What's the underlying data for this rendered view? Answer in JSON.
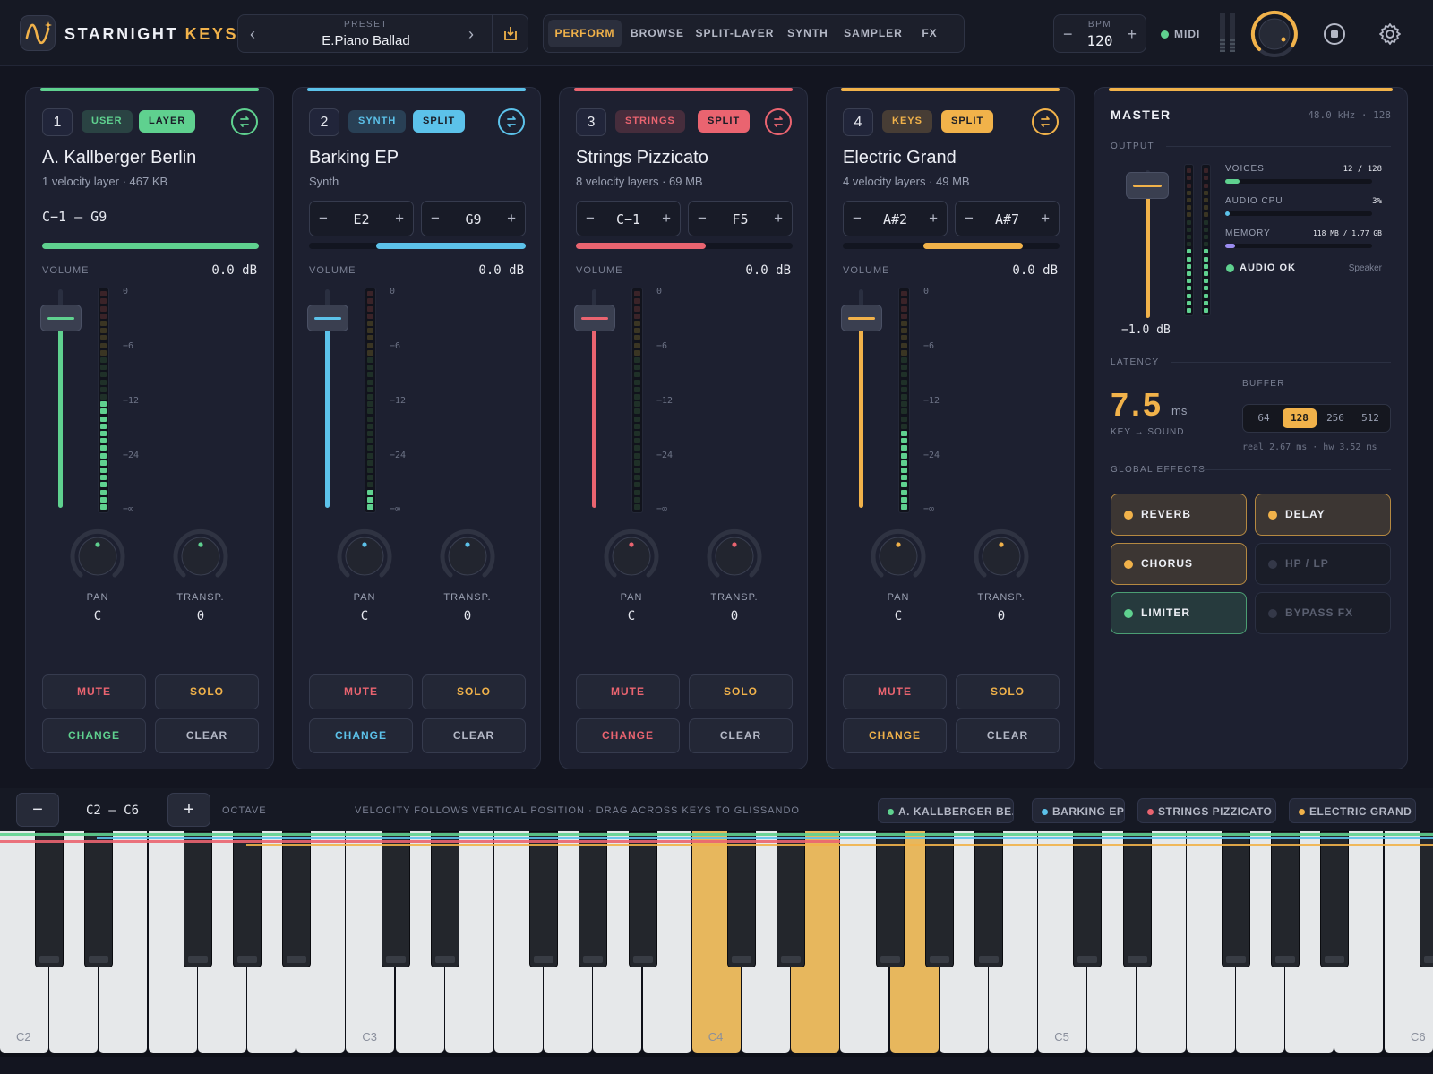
{
  "app": {
    "name_a": "STARNIGHT",
    "name_b": "KEYS"
  },
  "preset": {
    "label": "PRESET",
    "value": "E.Piano Ballad"
  },
  "nav": {
    "tabs": [
      "PERFORM",
      "BROWSE",
      "SPLIT-LAYER",
      "SYNTH",
      "SAMPLER",
      "FX"
    ],
    "active": "PERFORM"
  },
  "bpm": {
    "label": "BPM",
    "value": "120",
    "minus": "−",
    "plus": "+"
  },
  "midi": {
    "label": "MIDI"
  },
  "colors": {
    "green": "#5fd18f",
    "blue": "#5cc2ea",
    "red": "#ea6470",
    "orange": "#f1b24a",
    "purple": "#9b8cf0"
  },
  "channels": [
    {
      "num": "1",
      "tag": "USER",
      "mode": "LAYER",
      "name": "A. Kallberger Berlin",
      "sub": "1 velocity layer · 467 KB",
      "range_text": "C−1 — G9",
      "range_low": "",
      "range_high": "",
      "range_start": 0,
      "range_end": 1,
      "volume_label": "VOLUME",
      "volume": "0.0 dB",
      "fader": 0.9,
      "meter": 0.5,
      "pan_label": "PAN",
      "pan": "C",
      "transp_label": "TRANSP.",
      "transp": "0",
      "mute": "MUTE",
      "solo": "SOLO",
      "change": "CHANGE",
      "clear": "CLEAR",
      "color": "#5fd18f"
    },
    {
      "num": "2",
      "tag": "SYNTH",
      "mode": "SPLIT",
      "name": "Barking EP",
      "sub": "Synth",
      "range_text": "",
      "range_low": "E2",
      "range_high": "G9",
      "range_start": 0.31,
      "range_end": 1,
      "volume_label": "VOLUME",
      "volume": "0.0 dB",
      "fader": 0.9,
      "meter": 0.1,
      "pan_label": "PAN",
      "pan": "C",
      "transp_label": "TRANSP.",
      "transp": "0",
      "mute": "MUTE",
      "solo": "SOLO",
      "change": "CHANGE",
      "clear": "CLEAR",
      "color": "#5cc2ea"
    },
    {
      "num": "3",
      "tag": "STRINGS",
      "mode": "SPLIT",
      "name": "Strings Pizzicato",
      "sub": "8 velocity layers · 69 MB",
      "range_text": "",
      "range_low": "C−1",
      "range_high": "F5",
      "range_start": 0,
      "range_end": 0.6,
      "volume_label": "VOLUME",
      "volume": "0.0 dB",
      "fader": 0.9,
      "meter": 0,
      "pan_label": "PAN",
      "pan": "C",
      "transp_label": "TRANSP.",
      "transp": "0",
      "mute": "MUTE",
      "solo": "SOLO",
      "change": "CHANGE",
      "clear": "CLEAR",
      "color": "#ea6470"
    },
    {
      "num": "4",
      "tag": "KEYS",
      "mode": "SPLIT",
      "name": "Electric Grand",
      "sub": "4 velocity layers · 49 MB",
      "range_text": "",
      "range_low": "A#2",
      "range_high": "A#7",
      "range_start": 0.37,
      "range_end": 0.83,
      "volume_label": "VOLUME",
      "volume": "0.0 dB",
      "fader": 0.9,
      "meter": 0.35,
      "pan_label": "PAN",
      "pan": "C",
      "transp_label": "TRANSP.",
      "transp": "0",
      "mute": "MUTE",
      "solo": "SOLO",
      "change": "CHANGE",
      "clear": "CLEAR",
      "color": "#f1b24a"
    }
  ],
  "scale": [
    "0",
    "−6",
    "−12",
    "−24",
    "−∞"
  ],
  "master": {
    "title": "MASTER",
    "sr": "48.0 kHz · 128",
    "output_label": "OUTPUT",
    "output_db": "−1.0 dB",
    "fader": 0.9,
    "voices_label": "VOICES",
    "voices": "12 / 128",
    "voices_frac": 0.1,
    "cpu_label": "AUDIO CPU",
    "cpu": "3%",
    "cpu_frac": 0.03,
    "mem_label": "MEMORY",
    "mem": "118 MB / 1.77 GB",
    "mem_frac": 0.07,
    "audio_ok": "AUDIO OK",
    "device": "Speaker",
    "latency_label": "LATENCY",
    "latency": "7.5",
    "latency_unit": "ms",
    "key_sound": "KEY → SOUND",
    "buffer_label": "BUFFER",
    "buffers": [
      "64",
      "128",
      "256",
      "512"
    ],
    "buffer_sel": "128",
    "real": "real 2.67 ms · hw 3.52 ms",
    "fx_label": "GLOBAL EFFECTS",
    "fx": [
      {
        "name": "REVERB",
        "on": true
      },
      {
        "name": "DELAY",
        "on": true
      },
      {
        "name": "CHORUS",
        "on": true
      },
      {
        "name": "HP / LP",
        "on": false
      },
      {
        "name": "LIMITER",
        "on": true
      },
      {
        "name": "BYPASS FX",
        "on": false
      }
    ]
  },
  "keyboard": {
    "minus": "−",
    "plus": "+",
    "range": "C2 — C6",
    "octave": "OCTAVE",
    "hint": "VELOCITY FOLLOWS VERTICAL POSITION · DRAG ACROSS KEYS TO GLISSANDO",
    "chips": [
      "A. KALLBERGER BE...",
      "BARKING EP",
      "STRINGS PIZZICATO",
      "ELECTRIC GRAND"
    ],
    "labels": [
      "C2",
      "C3",
      "C4",
      "C5",
      "C6"
    ]
  }
}
